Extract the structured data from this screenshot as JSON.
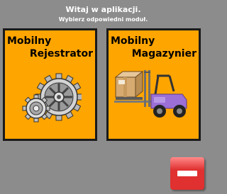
{
  "header": {
    "title": "Witaj w aplikacji.",
    "subtitle": "Wybierz odpowiedni moduł."
  },
  "modules": [
    {
      "line1": "Mobilny",
      "line2": "Rejestrator",
      "icon": "gears-icon"
    },
    {
      "line1": "Mobilny",
      "line2": "Magazynier",
      "icon": "forklift-icon"
    }
  ],
  "exit_button": {
    "icon": "minus-icon"
  },
  "colors": {
    "background": "#8c8c8c",
    "tile": "#ffa500",
    "tile_border": "#1a1a1a",
    "exit": "#e03030",
    "text_header": "#ffffff"
  }
}
